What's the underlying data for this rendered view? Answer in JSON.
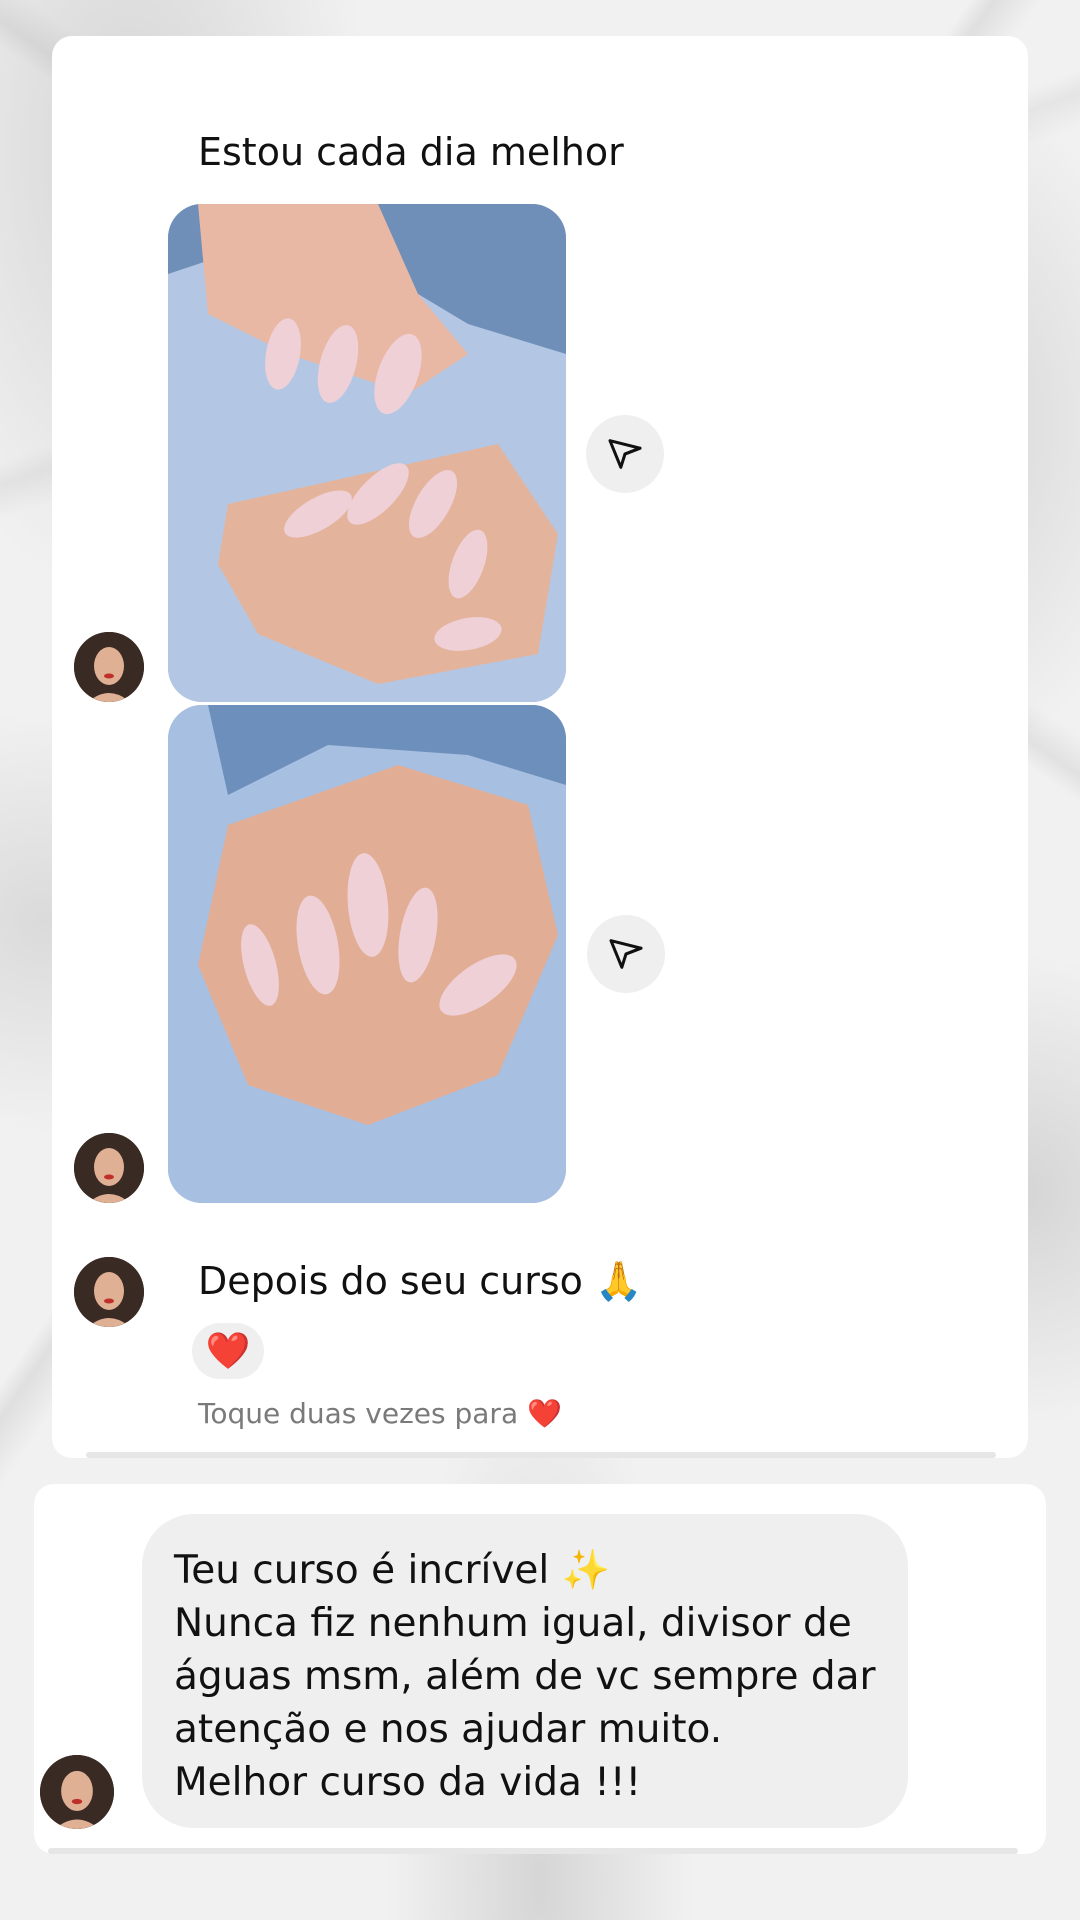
{
  "thread": {
    "messages": [
      {
        "type": "text",
        "sender": "other",
        "text": "Estou cada dia melhor"
      },
      {
        "type": "photo",
        "sender": "other",
        "description": "nails-photo-1"
      },
      {
        "type": "photo",
        "sender": "other",
        "description": "nails-photo-2"
      },
      {
        "type": "text",
        "sender": "other",
        "text": "Depois do seu curso 🙏",
        "reaction": "❤️"
      }
    ],
    "hint": "Toque duas vezes para ❤️"
  },
  "quote": {
    "lines": [
      "Teu curso é incrível ✨",
      "Nunca fiz nenhum igual, divisor de",
      "águas msm, além de vc sempre dar",
      "atenção e nos ajudar muito.",
      "Melhor curso da vida !!!"
    ]
  },
  "icons": {
    "share": "paper-plane-icon",
    "avatar": "profile-avatar"
  },
  "colors": {
    "card": "#ffffff",
    "bubble": "#efefef",
    "hint_text": "#7a7a7a",
    "photo_background": "#a9bedf"
  }
}
